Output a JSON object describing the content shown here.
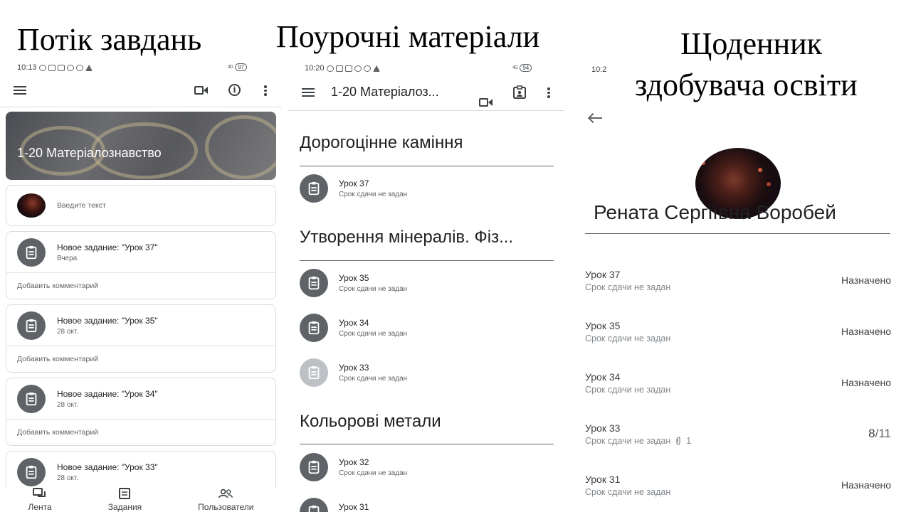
{
  "titles": {
    "stream": "Потік завдань",
    "materials": "Поурочні матеріали",
    "diary_line1": "Щоденник",
    "diary_line2": "здобувача освіти"
  },
  "panel1": {
    "time": "10:13",
    "battery": "97",
    "signal": "4G",
    "class_name": "1-20 Матеріалознавство",
    "post_placeholder": "Введите текст",
    "cards": [
      {
        "title": "Новое задание: \"Урок 37\"",
        "date": "Вчера",
        "comment": "Добавить комментарий"
      },
      {
        "title": "Новое задание: \"Урок 35\"",
        "date": "28 окт.",
        "comment": "Добавить комментарий"
      },
      {
        "title": "Новое задание: \"Урок 34\"",
        "date": "28 окт.",
        "comment": "Добавить комментарий"
      },
      {
        "title": "Новое задание: \"Урок 33\"",
        "date": "28 окт."
      }
    ],
    "nav": [
      "Лента",
      "Задания",
      "Пользователи"
    ]
  },
  "panel2": {
    "time": "10:20",
    "battery": "94",
    "signal": "4G",
    "toolbar_title": "1-20 Матеріалоз...",
    "topics": [
      "Дорогоцінне каміння",
      "Утворення мінералів. Фіз...",
      "Кольорові метали"
    ],
    "items": [
      {
        "title": "Урок 37",
        "sub": "Срок сдачи не задан"
      },
      {
        "title": "Урок 35",
        "sub": "Срок сдачи не задан"
      },
      {
        "title": "Урок 34",
        "sub": "Срок сдачи не задан"
      },
      {
        "title": "Урок 33",
        "sub": "Срок сдачи не задан"
      },
      {
        "title": "Урок 32",
        "sub": "Срок сдачи не задан"
      },
      {
        "title": "Урок 31"
      }
    ]
  },
  "panel3": {
    "time": "10:2",
    "student_name": "Рената Сергіївна Воробей",
    "rows": [
      {
        "title": "Урок 37",
        "sub": "Срок сдачи не задан",
        "status": "Назначено"
      },
      {
        "title": "Урок 35",
        "sub": "Срок сдачи не задан",
        "status": "Назначено"
      },
      {
        "title": "Урок 34",
        "sub": "Срок сдачи не задан",
        "status": "Назначено"
      },
      {
        "title": "Урок 33",
        "sub": "Срок сдачи не задан",
        "attachments": "1",
        "grade": "8",
        "grade_max": "/11"
      },
      {
        "title": "Урок 31",
        "sub": "Срок сдачи не задан",
        "status": "Назначено"
      }
    ]
  }
}
